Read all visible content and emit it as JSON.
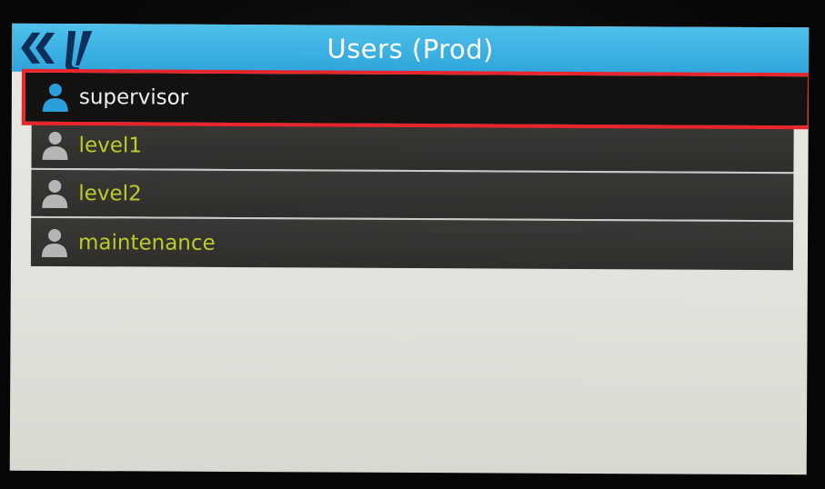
{
  "header": {
    "title": "Users (Prod)",
    "logo_icon": "kv-logo-icon",
    "color": "#36aee0"
  },
  "users": [
    {
      "label": "supervisor",
      "icon": "user-icon",
      "selected": true,
      "icon_color": "#2b9fdc",
      "text_color": "#eeeeee"
    },
    {
      "label": "level1",
      "icon": "user-icon",
      "selected": false,
      "icon_color": "#b5b5b5",
      "text_color": "#b8cc2e"
    },
    {
      "label": "level2",
      "icon": "user-icon",
      "selected": false,
      "icon_color": "#b5b5b5",
      "text_color": "#b8cc2e"
    },
    {
      "label": "maintenance",
      "icon": "user-icon",
      "selected": false,
      "icon_color": "#b5b5b5",
      "text_color": "#b8cc2e"
    }
  ],
  "highlight_color": "#e8242c"
}
